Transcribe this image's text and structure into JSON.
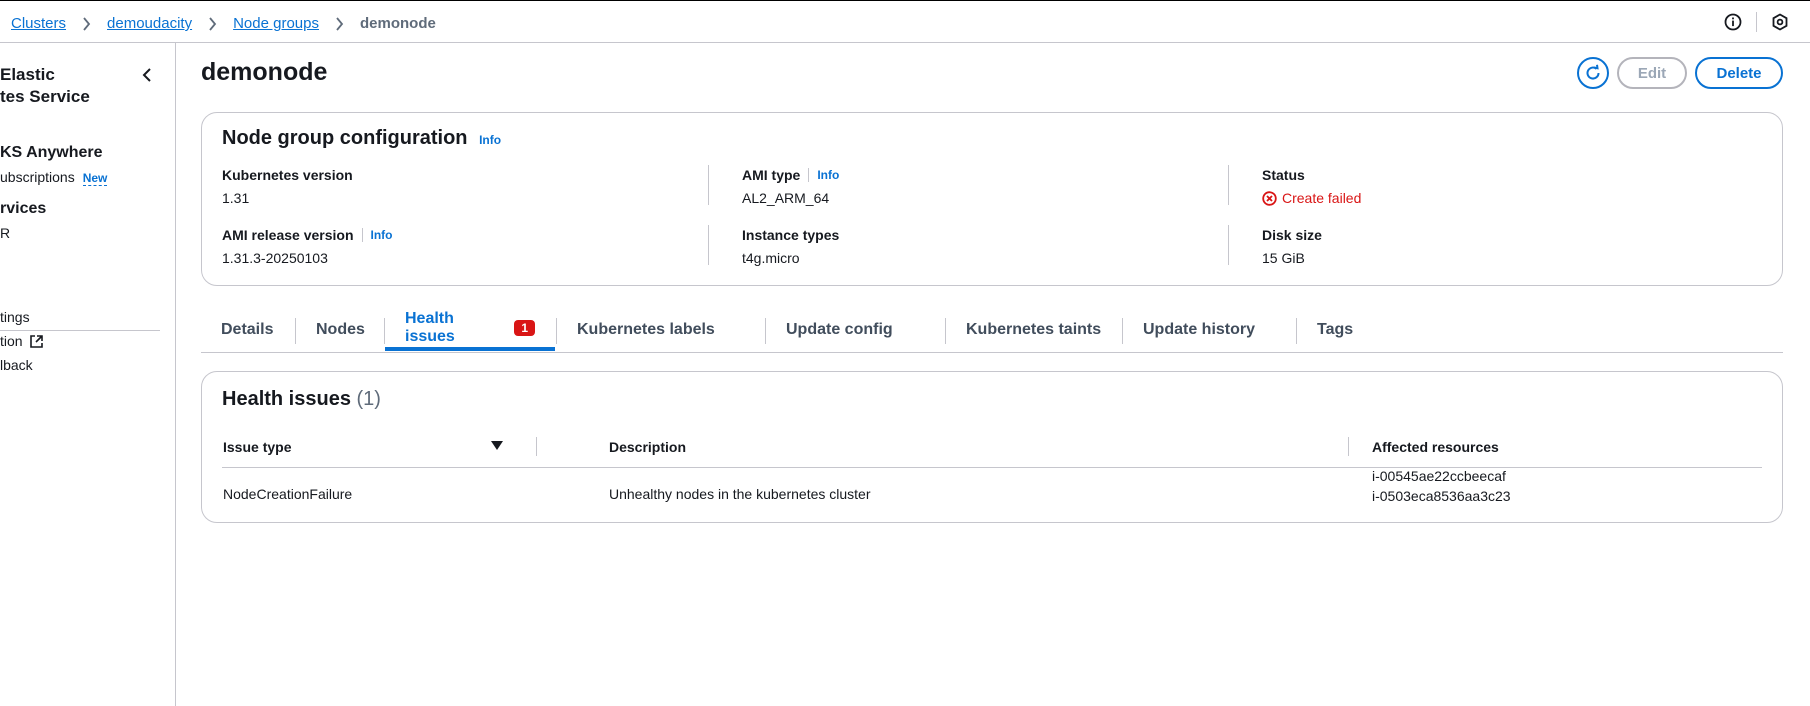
{
  "breadcrumb": {
    "items": [
      "Clusters",
      "demoudacity",
      "Node groups"
    ],
    "current": "demonode"
  },
  "top_icons": [
    "info-circle-icon",
    "settings-hexagon-icon"
  ],
  "sidebar": {
    "title_line1": "Elastic",
    "title_line2": "tes Service",
    "section_anywhere": "KS Anywhere",
    "subscriptions": "ubscriptions",
    "new_badge": "New",
    "section_services": "rvices",
    "services_item": "R",
    "settings_item": "tings",
    "documentation_item": "tion",
    "feedback_item": "lback"
  },
  "page": {
    "title": "demonode",
    "edit_label": "Edit",
    "delete_label": "Delete"
  },
  "config": {
    "title": "Node group configuration",
    "info": "Info",
    "kubernetes_version_label": "Kubernetes version",
    "kubernetes_version": "1.31",
    "ami_release_label": "AMI release version",
    "ami_release": "1.31.3-20250103",
    "ami_type_label": "AMI type",
    "ami_type": "AL2_ARM_64",
    "instance_types_label": "Instance types",
    "instance_types": "t4g.micro",
    "status_label": "Status",
    "status": "Create failed",
    "disk_size_label": "Disk size",
    "disk_size": "15 GiB"
  },
  "tabs": [
    {
      "label": "Details"
    },
    {
      "label": "Nodes"
    },
    {
      "label": "Health issues",
      "badge": "1",
      "active": true
    },
    {
      "label": "Kubernetes labels"
    },
    {
      "label": "Update config"
    },
    {
      "label": "Kubernetes taints"
    },
    {
      "label": "Update history"
    },
    {
      "label": "Tags"
    }
  ],
  "health": {
    "title": "Health issues",
    "count": "(1)",
    "columns": [
      "Issue type",
      "Description",
      "Affected resources"
    ],
    "rows": [
      {
        "issue_type": "NodeCreationFailure",
        "description": "Unhealthy nodes in the kubernetes cluster",
        "resources": [
          "i-00545ae22ccbeecaf",
          "i-0503eca8536aa3c23"
        ]
      }
    ]
  },
  "colors": {
    "link": "#0972d3",
    "error": "#d91515",
    "border": "#c6c6cd",
    "text": "#16191f"
  }
}
